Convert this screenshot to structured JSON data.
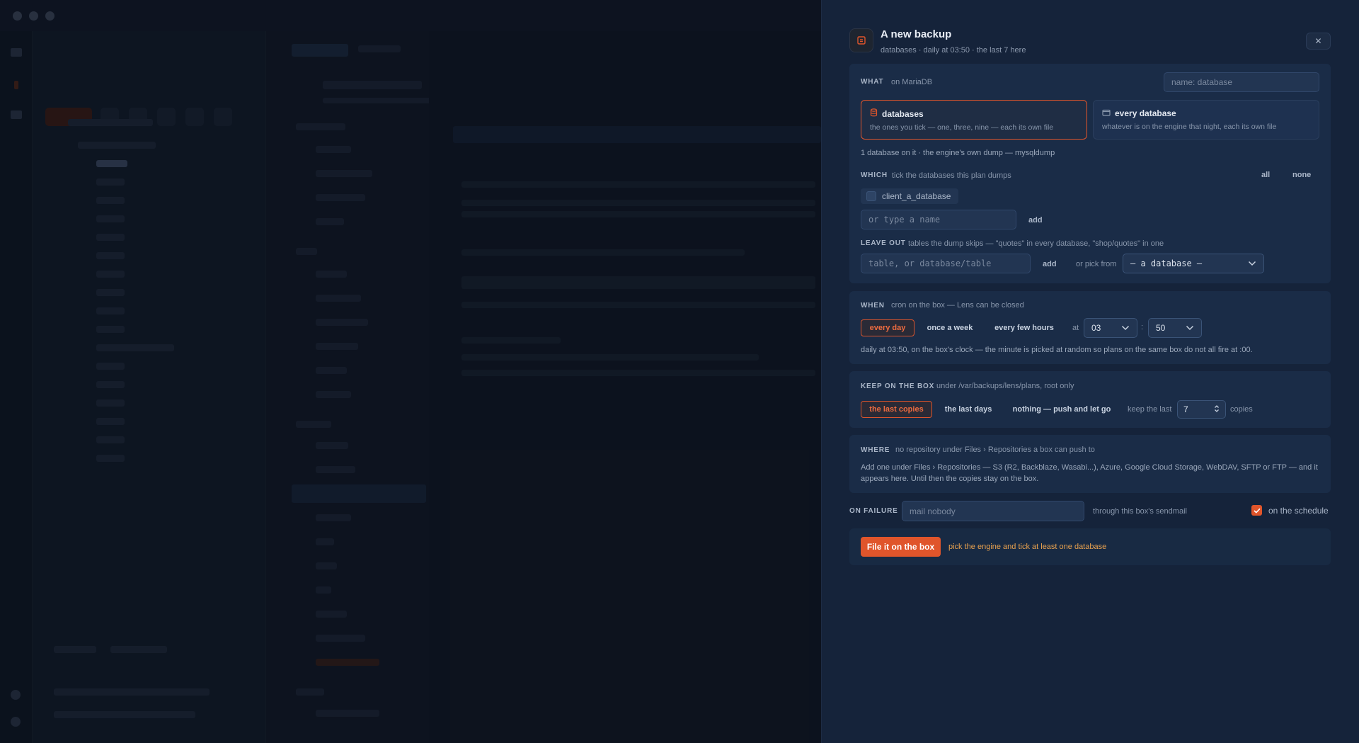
{
  "drawer": {
    "title": "A new backup",
    "subtitle": "databases · daily at 03:50 · the last 7 here",
    "close_label": "✕"
  },
  "what": {
    "label": "WHAT",
    "hint": "on MariaDB",
    "name_placeholder": "name: database",
    "options": [
      {
        "title": "databases",
        "sub": "the ones you tick — one, three, nine — each its own file",
        "selected": true
      },
      {
        "title": "every database",
        "sub": "whatever is on the engine that night, each its own file",
        "selected": false
      }
    ],
    "engine_info": "1 database on it · the engine's own dump — mysqldump"
  },
  "which": {
    "label": "WHICH",
    "hint": "tick the databases this plan dumps",
    "all_label": "all",
    "none_label": "none",
    "databases": [
      "client_a_database"
    ],
    "type_placeholder": "or type a name",
    "add_label": "add"
  },
  "leave_out": {
    "label": "LEAVE OUT",
    "hint": "tables the dump skips — \"quotes\" in every database, \"shop/quotes\" in one",
    "table_placeholder": "table, or database/table",
    "add_label": "add",
    "pick_from_label": "or pick from",
    "database_select": "— a database —"
  },
  "when": {
    "label": "WHEN",
    "hint": "cron on the box — Lens can be closed",
    "options": [
      "every day",
      "once a week",
      "every few hours"
    ],
    "selected": "every day",
    "at_label": "at",
    "hour": "03",
    "colon": ":",
    "minute": "50",
    "note": "daily at 03:50, on the box's clock — the minute is picked at random so plans on the same box do not all fire at :00."
  },
  "keep": {
    "label": "KEEP ON THE BOX",
    "hint": "under /var/backups/lens/plans, root only",
    "options": [
      "the last copies",
      "the last days",
      "nothing — push and let go"
    ],
    "selected": "the last copies",
    "keep_label": "keep the last",
    "count": "7",
    "unit_label": "copies"
  },
  "where": {
    "label": "WHERE",
    "hint": "no repository under Files › Repositories a box can push to",
    "note_line1": "Add one under Files › Repositories — S3 (R2, Backblaze, Wasabi...), Azure, Google Cloud Storage, WebDAV, SFTP or FTP — and it",
    "note_line2": "appears here. Until then the copies stay on the box."
  },
  "on_failure": {
    "label": "ON FAILURE",
    "mail_placeholder": "mail nobody",
    "through_label": "through this box's sendmail",
    "schedule_label": "on the schedule",
    "schedule_checked": true
  },
  "footer": {
    "submit_label": "File it on the box",
    "warning": "pick the engine and tick at least one database"
  },
  "colors": {
    "accent": "#e0552b",
    "warning": "#e9a24f",
    "drawer_bg": "#15233a",
    "card_bg": "#1a2c47"
  },
  "icons": {
    "header": "archive-icon",
    "databases": "database-icon",
    "every_database": "folder-icon",
    "close": "close-icon"
  }
}
